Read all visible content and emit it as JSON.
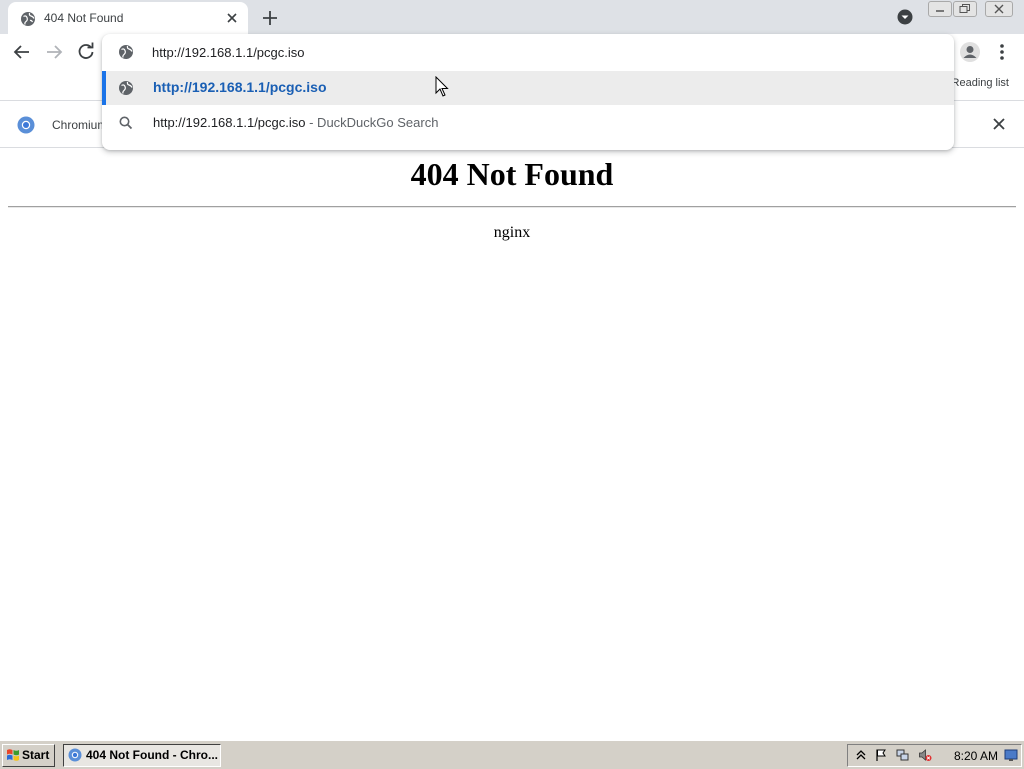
{
  "browser": {
    "tab": {
      "title": "404 Not Found"
    },
    "omnibox": {
      "value": "http://192.168.1.1/pcgc.iso",
      "suggestions": [
        {
          "text": "http://192.168.1.1/pcgc.iso",
          "icon": "globe-icon"
        },
        {
          "text": "http://192.168.1.1/pcgc.iso",
          "sub": " - DuckDuckGo Search",
          "icon": "search-icon"
        }
      ]
    },
    "bookmarks": {
      "reading_list": "Reading list"
    },
    "infobar": {
      "text": "Chromium"
    }
  },
  "page": {
    "heading": "404 Not Found",
    "server": "nginx"
  },
  "taskbar": {
    "start_label": "Start",
    "task_label": "404 Not Found - Chro...",
    "clock": "8:20 AM"
  },
  "colors": {
    "accent": "#1a73e8",
    "suggestion_link": "#1a5fb4",
    "tabstrip_bg": "#dee1e6",
    "taskbar_bg": "#d4d0c8"
  }
}
